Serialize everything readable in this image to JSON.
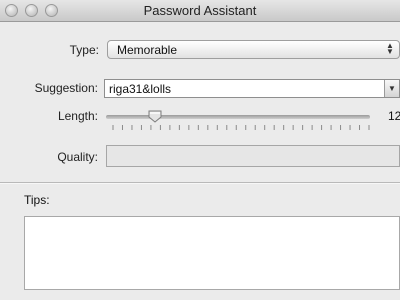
{
  "window": {
    "title": "Password Assistant"
  },
  "form": {
    "type_label": "Type:",
    "type_value": "Memorable",
    "suggestion_label": "Suggestion:",
    "suggestion_value": "riga31&lolls",
    "length_label": "Length:",
    "length_value": "12",
    "quality_label": "Quality:"
  },
  "tips": {
    "label": "Tips:"
  },
  "icons": {
    "traffic_lights": [
      "close-icon",
      "minimize-icon",
      "zoom-icon"
    ],
    "popup_stepper": "updown-arrows-icon",
    "combo_arrow": "chevron-down-icon"
  }
}
